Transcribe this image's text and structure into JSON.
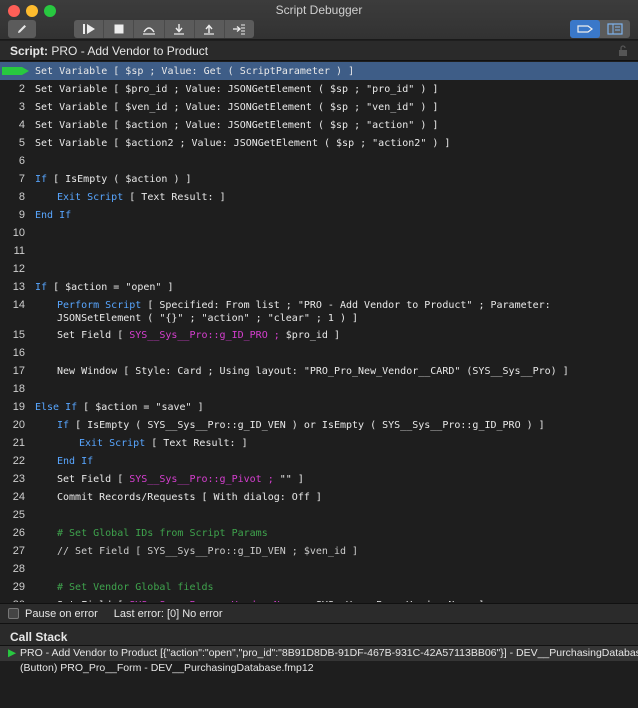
{
  "window": {
    "title": "Script Debugger"
  },
  "toolbar": {
    "edit_icon": "pencil-icon",
    "group": [
      "step-over-play-icon",
      "stop-icon",
      "step-over-icon",
      "step-into-icon",
      "step-out-icon",
      "set-next-step-icon"
    ],
    "right": [
      "breakpoint-arrow-icon",
      "data-viewer-icon"
    ]
  },
  "script_header": {
    "label": "Script:",
    "name": "PRO - Add Vendor to Product"
  },
  "code_lines": [
    {
      "num": "1",
      "active": true,
      "segs": [
        [
          "Set Variable [ $sp ; Value: Get ( ScriptParameter ) ]",
          ""
        ]
      ]
    },
    {
      "num": "2",
      "segs": [
        [
          "Set Variable [ $pro_id ; Value: JSONGetElement ( $sp ; \"pro_id\" ) ]",
          ""
        ]
      ]
    },
    {
      "num": "3",
      "segs": [
        [
          "Set Variable [ $ven_id ; Value: JSONGetElement ( $sp ; \"ven_id\" ) ]",
          ""
        ]
      ]
    },
    {
      "num": "4",
      "segs": [
        [
          "Set Variable [ $action ; Value: JSONGetElement ( $sp ; \"action\" ) ]",
          ""
        ]
      ]
    },
    {
      "num": "5",
      "segs": [
        [
          "Set Variable [ $action2 ; Value: JSONGetElement ( $sp ; \"action2\" ) ]",
          ""
        ]
      ]
    },
    {
      "num": "6",
      "segs": []
    },
    {
      "num": "7",
      "segs": [
        [
          "If",
          "kw"
        ],
        [
          " [ IsEmpty ( $action ) ]",
          ""
        ]
      ]
    },
    {
      "num": "8",
      "indent": 1,
      "segs": [
        [
          "Exit Script",
          "kw"
        ],
        [
          " [ Text Result: ]",
          ""
        ]
      ]
    },
    {
      "num": "9",
      "segs": [
        [
          "End If",
          "kw"
        ]
      ]
    },
    {
      "num": "10",
      "segs": []
    },
    {
      "num": "11",
      "segs": []
    },
    {
      "num": "12",
      "segs": []
    },
    {
      "num": "13",
      "segs": [
        [
          "If",
          "kw"
        ],
        [
          " [ $action = \"open\" ]",
          ""
        ]
      ]
    },
    {
      "num": "14",
      "indent": 1,
      "tall": true,
      "segs": [
        [
          "Perform Script",
          "kw"
        ],
        [
          " [ Specified: From list ; \"PRO - Add Vendor to Product\" ; Parameter:\nJSONSetElement ( \"{}\" ; \"action\" ; \"clear\" ; 1 ) ]",
          ""
        ]
      ]
    },
    {
      "num": "15",
      "indent": 1,
      "segs": [
        [
          "Set Field [ ",
          ""
        ],
        [
          "SYS__Sys__Pro::g_ID_PRO ;",
          "fld"
        ],
        [
          " $pro_id ]",
          ""
        ]
      ]
    },
    {
      "num": "16",
      "segs": []
    },
    {
      "num": "17",
      "indent": 1,
      "segs": [
        [
          "New Window [ Style: Card ; Using layout: \"PRO_Pro_New_Vendor__CARD\" (SYS__Sys__Pro) ]",
          ""
        ]
      ]
    },
    {
      "num": "18",
      "segs": []
    },
    {
      "num": "19",
      "segs": [
        [
          "Else If",
          "kw"
        ],
        [
          " [ $action = \"save\" ]",
          ""
        ]
      ]
    },
    {
      "num": "20",
      "indent": 1,
      "segs": [
        [
          "If",
          "kw"
        ],
        [
          " [ IsEmpty ( SYS__Sys__Pro::g_ID_VEN ) or IsEmpty ( SYS__Sys__Pro::g_ID_PRO ) ]",
          ""
        ]
      ]
    },
    {
      "num": "21",
      "indent": 2,
      "segs": [
        [
          "Exit Script",
          "kw"
        ],
        [
          " [ Text Result: ]",
          ""
        ]
      ]
    },
    {
      "num": "22",
      "indent": 1,
      "segs": [
        [
          "End If",
          "kw"
        ]
      ]
    },
    {
      "num": "23",
      "indent": 1,
      "segs": [
        [
          "Set Field [ ",
          ""
        ],
        [
          "SYS__Sys__Pro::g_Pivot ;",
          "fld"
        ],
        [
          " \"\" ]",
          ""
        ]
      ]
    },
    {
      "num": "24",
      "indent": 1,
      "segs": [
        [
          "Commit Records/Requests [ With dialog: Off ]",
          ""
        ]
      ]
    },
    {
      "num": "25",
      "segs": []
    },
    {
      "num": "26",
      "indent": 1,
      "segs": [
        [
          "# Set Global IDs from Script Params",
          "cmt"
        ]
      ]
    },
    {
      "num": "27",
      "indent": 1,
      "segs": [
        [
          "// Set Field [ SYS__Sys__Pro::g_ID_VEN ; $ven_id ]",
          "dis"
        ]
      ]
    },
    {
      "num": "28",
      "segs": []
    },
    {
      "num": "29",
      "indent": 1,
      "segs": [
        [
          "# Set Vendor Global fields",
          "cmt"
        ]
      ]
    },
    {
      "num": "30",
      "indent": 1,
      "segs": [
        [
          "Set Field [ ",
          ""
        ],
        [
          "SYS__Sys__Pro::g_Vendor_Name ;",
          "fld"
        ],
        [
          " SYS__Ven__Pro::Vendor_Name ]",
          ""
        ]
      ]
    }
  ],
  "status": {
    "pause_label": "Pause on error",
    "last_error": "Last error: [0] No error"
  },
  "call_stack": {
    "header": "Call Stack",
    "rows": [
      "PRO - Add Vendor to Product [{\"action\":\"open\",\"pro_id\":\"8B91D8DB-91DF-467B-931C-42A57113BB06\"}] - DEV__PurchasingDatabase.fm...",
      "(Button) PRO_Pro__Form - DEV__PurchasingDatabase.fmp12"
    ]
  },
  "colors": {
    "keyword": "#58a6ff",
    "field": "#d63fd0",
    "comment": "#3fa34d",
    "active_line": "#3e5d87"
  }
}
